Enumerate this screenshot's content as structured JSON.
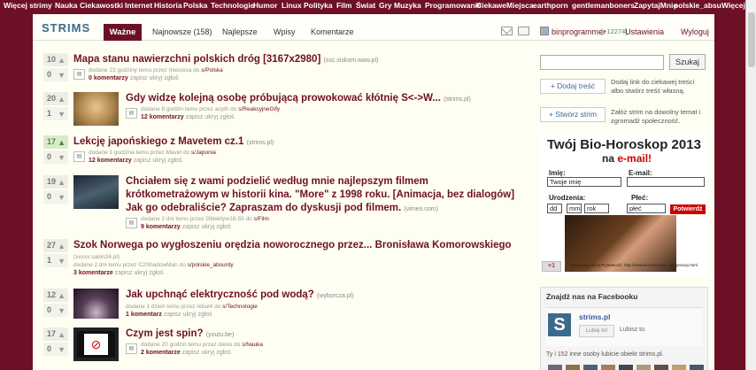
{
  "topnav": {
    "items": [
      "Więcej strimy",
      "Nauka",
      "Ciekawostki",
      "Internet",
      "Historia",
      "Polska",
      "Technologie",
      "Humor",
      "Linux",
      "Polityka",
      "Film",
      "Świat",
      "Gry",
      "Muzyka",
      "Programowanie",
      "CiekaweMiejsca",
      "earthporn",
      "gentlemanboners",
      "ZapytajMnie",
      "polskie_absu"
    ],
    "more": "Więcej"
  },
  "header": {
    "logo": "STRIMS",
    "tabs": [
      {
        "label": "Ważne",
        "active": true
      },
      {
        "label": "Najnowsze (158)"
      },
      {
        "label": "Najlepsze"
      },
      {
        "label": "Wpisy"
      },
      {
        "label": "Komentarze"
      }
    ],
    "user": "binprogrammer",
    "karma": "[+12274]",
    "settings": "Ustawienia",
    "logout": "Wyloguj"
  },
  "posts": [
    {
      "up": "10",
      "down": "0",
      "title": "Mapa stanu nawierzchni polskich dróg [3167x2980]",
      "source": "(ssc.siskom.waw.pl)",
      "meta": "dodane 23 godziny temu przez mieciosa do",
      "strim": "s/Polska",
      "comments": "0 komentarzy",
      "highlight": false
    },
    {
      "up": "20",
      "down": "1",
      "title": "Gdy widzę kolejną osobę próbującą prowokować kłótnię S<->W...",
      "source": "(strims.pl)",
      "meta": "dodane 8 godzin temu przez acyth do",
      "strim": "s/ReakcyjneGify",
      "comments": "12 komentarzy",
      "highlight": false
    },
    {
      "up": "17",
      "down": "0",
      "title": "Lekcję japońskiego z Mavetem cz.1",
      "source": "(strims.pl)",
      "meta": "dodane 1 godzina temu przez Mavet do",
      "strim": "s/Japonia",
      "comments": "12 komentarzy",
      "highlight": true
    },
    {
      "up": "19",
      "down": "0",
      "title_lines": [
        "Chciałem się z wami podzielić według mnie najlepszym filmem",
        "krótkometrażowym w historii kina. \"More\" z 1998 roku. [Animacja, bez dialogów]",
        "Jak go odebraliście? Zapraszam do dyskusji pod filmem."
      ],
      "source": "(vimeo.com)",
      "meta": "dodane 2 dni temu przez Obiektyw18-55 do",
      "strim": "s/Film",
      "comments": "9 komentarzy",
      "highlight": false
    },
    {
      "up": "27",
      "down": "1",
      "title": "Szok Norwega po wygłoszeniu orędzia noworocznego przez... Bronisława Komorowskiego",
      "source": "(xxxxx.salon24.pl)",
      "meta": "dodane 2 dni temu przez C2ShadowMan do",
      "strim": "s/polskie_absurdy",
      "comments": "3 komentarze",
      "highlight": false
    },
    {
      "up": "12",
      "down": "0",
      "title": "Jak upchnąć elektryczność pod wodą?",
      "source": "(wyborcza.pl)",
      "meta": "dodane 1 dzień temu przez rebul4 do",
      "strim": "s/Technologie",
      "comments": "1 komentarz",
      "highlight": false
    },
    {
      "up": "17",
      "down": "0",
      "title": "Czym jest spin?",
      "source": "(youtu.be)",
      "meta": "dodane 20 godzin temu przez danio do",
      "strim": "s/Nauka",
      "comments": "2 komentarze",
      "highlight": false
    }
  ],
  "actions": {
    "save": "zapisz",
    "hide": "ukryj",
    "report": "zgłoś"
  },
  "sidebar": {
    "search_button": "Szukaj",
    "add_content": "+ Dodaj treść",
    "add_content_desc": "Dodaj link do ciekawej treści albo stwórz treść własną.",
    "create_strim": "+ Stwórz strim",
    "create_strim_desc": "Załóż strim na dowolny temat i zgromadź społeczność."
  },
  "ad": {
    "title": "Twój Bio-Horoskop 2013",
    "sub_pre": "na",
    "sub_red": "e-mail!",
    "imie": "Imię:",
    "imie_val": "Twoje imię",
    "email": "E-mail:",
    "urodzenia": "Urodzenia:",
    "dd": "dd",
    "mm": "mm",
    "rok": "rok",
    "plec": "Płeć:",
    "plec_val": "płeć",
    "submit": "Potwierdź",
    "gplus": "+1",
    "fine": "Przeczytaj naszą Prywatność: http://www.bio-horoskop.com/privacy.html"
  },
  "facebook": {
    "title": "Znajdź nas na Facebooku",
    "name": "strims.pl",
    "like": "Lubię to!",
    "likes": "Lubisz to.",
    "count": "Ty i 152 inne osoby lubicie obiekt strims.pl."
  },
  "colors": {
    "brand": "#6e1025",
    "accent": "#3c6a8c",
    "green": "#4a8a4a",
    "bg": "#fffef2"
  }
}
